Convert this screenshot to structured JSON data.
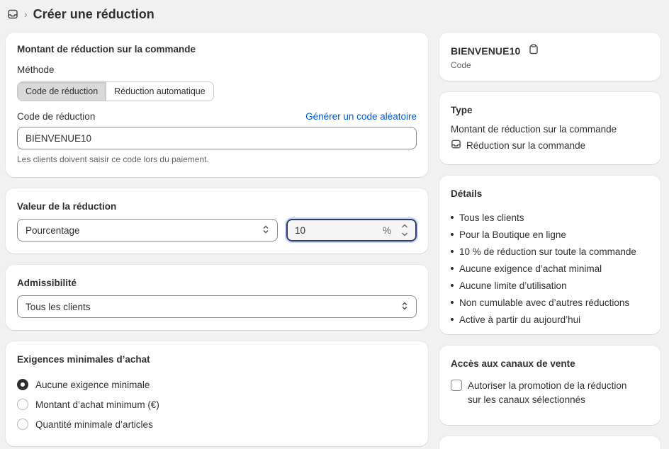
{
  "header": {
    "title": "Créer une réduction"
  },
  "order_amount": {
    "title": "Montant de réduction sur la commande",
    "method_label": "Méthode",
    "methods": [
      "Code de réduction",
      "Réduction automatique"
    ],
    "code_label": "Code de réduction",
    "generate_link": "Générer un code aléatoire",
    "code_value": "BIENVENUE10",
    "help": "Les clients doivent saisir ce code lors du paiement."
  },
  "value": {
    "title": "Valeur de la réduction",
    "type_selected": "Pourcentage",
    "amount": "10",
    "suffix": "%"
  },
  "eligibility": {
    "title": "Admissibilité",
    "selected": "Tous les clients"
  },
  "min_requirements": {
    "title": "Exigences minimales d’achat",
    "options": [
      "Aucune exigence minimale",
      "Montant d’achat minimum (€)",
      "Quantité minimale d’articles"
    ],
    "selected_index": 0
  },
  "summary": {
    "code": "BIENVENUE10",
    "code_sub": "Code",
    "type_title": "Type",
    "type_value": "Montant de réduction sur la commande",
    "type_detail": "Réduction sur la commande",
    "details_title": "Détails",
    "details": [
      "Tous les clients",
      "Pour la Boutique en ligne",
      "10 % de réduction sur toute la commande",
      "Aucune exigence d’achat minimal",
      "Aucune limite d’utilisation",
      "Non cumulable avec d’autres réductions",
      "Active à partir du aujourd’hui"
    ],
    "channels_title": "Accès aux canaux de vente",
    "channels_checkbox": "Autoriser la promotion de la réduction sur les canaux sélectionnés"
  },
  "colors": {
    "link": "#005bd3",
    "text": "#303030",
    "background": "#f1f1f1"
  }
}
